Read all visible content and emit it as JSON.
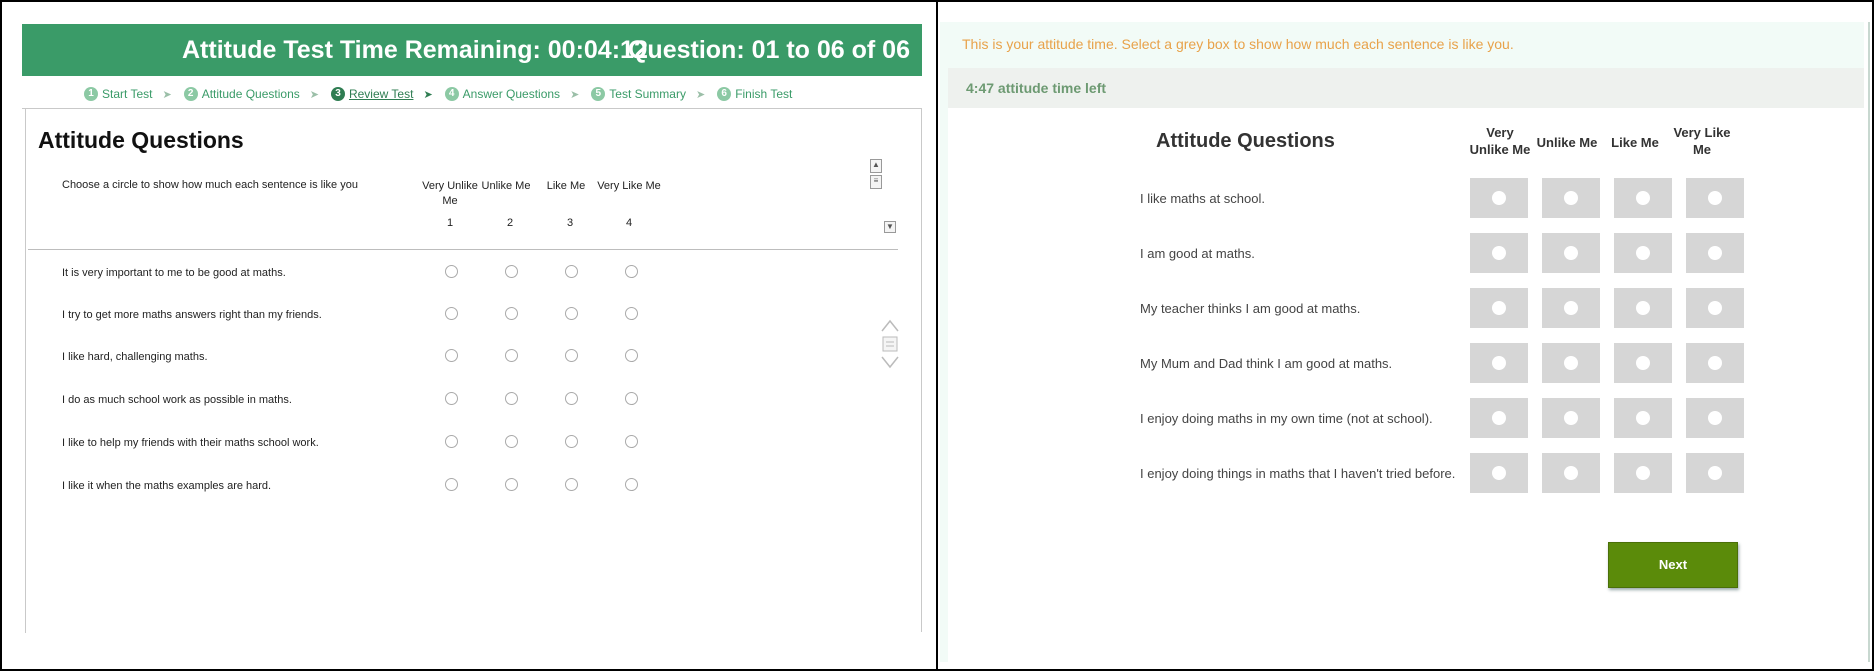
{
  "left": {
    "header": {
      "title": "Attitude Test Time Remaining: 00:04:12",
      "question_count": "Question: 01 to 06 of 06"
    },
    "steps": [
      {
        "num": "1",
        "label": "Start Test",
        "active": false
      },
      {
        "num": "2",
        "label": "Attitude Questions",
        "active": false
      },
      {
        "num": "3",
        "label": "Review Test",
        "active": true
      },
      {
        "num": "4",
        "label": "Answer Questions",
        "active": false
      },
      {
        "num": "5",
        "label": "Test Summary",
        "active": false
      },
      {
        "num": "6",
        "label": "Finish Test",
        "active": false
      }
    ],
    "section_title": "Attitude Questions",
    "instruction": "Choose a circle to show how much each sentence is like you",
    "columns": [
      {
        "label": "Very Unlike Me",
        "num": "1"
      },
      {
        "label": "Unlike Me",
        "num": "2"
      },
      {
        "label": "Like Me",
        "num": "3"
      },
      {
        "label": "Very Like Me",
        "num": "4"
      }
    ],
    "statements": [
      "It is very important to me to be good at maths.",
      "I try to get more maths answers right than my friends.",
      "I like hard, challenging maths.",
      "I do as much school work as possible in maths.",
      "I like to help my friends with their maths school work.",
      "I like it when the maths examples are hard."
    ]
  },
  "right": {
    "instruction": "This is your attitude time. Select a grey box to show how much each sentence is like you.",
    "time_left": "4:47 attitude time left",
    "section_title": "Attitude Questions",
    "columns": [
      "Very Unlike Me",
      "Unlike Me",
      "Like Me",
      "Very Like Me"
    ],
    "statements": [
      "I like maths at school.",
      "I am good at maths.",
      "My teacher thinks I am good at maths.",
      "My Mum and Dad think I am good at maths.",
      "I enjoy doing maths in my own time (not at school).",
      "I enjoy doing things in maths that I haven't tried before."
    ],
    "next_label": "Next"
  },
  "colors": {
    "header_green": "#3a9b68",
    "next_green": "#5b8b0a",
    "instruction_orange": "#e8a24a",
    "timer_green": "#6d9a72",
    "cell_grey": "#d6d6d6"
  }
}
